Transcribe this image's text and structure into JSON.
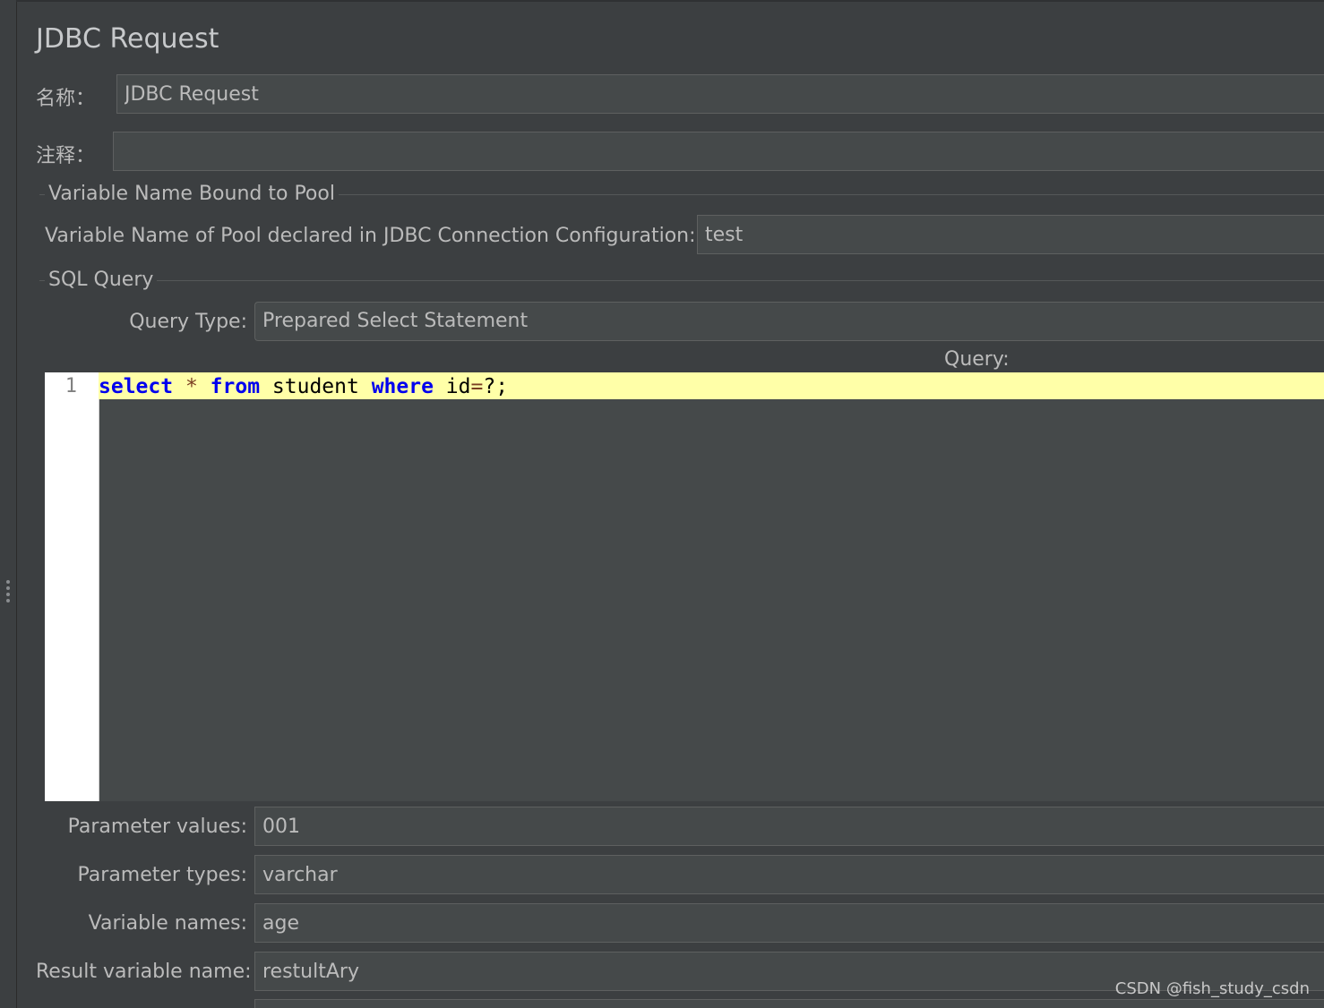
{
  "panel": {
    "title": "JDBC Request",
    "name_label": "名称：",
    "name_value": "JDBC Request",
    "comment_label": "注释：",
    "comment_value": ""
  },
  "pool_group": {
    "title": "Variable Name Bound to Pool",
    "pool_label": "Variable Name of Pool declared in JDBC Connection Configuration:",
    "pool_value": "test"
  },
  "sql_group": {
    "title": "SQL Query",
    "query_type_label": "Query Type:",
    "query_type_value": "Prepared Select Statement",
    "query_label": "Query:",
    "editor": {
      "line_number": "1",
      "tokens": [
        "select",
        " ",
        "*",
        " ",
        "from",
        " student ",
        "where",
        " id",
        "=",
        "?;"
      ]
    }
  },
  "params": {
    "values_label": "Parameter values:",
    "values_value": "001",
    "types_label": "Parameter types:",
    "types_value": "varchar",
    "varnames_label": "Variable names:",
    "varnames_value": "age",
    "result_label": "Result variable name:",
    "result_value": "restultAry"
  },
  "watermark": "CSDN @fish_study_csdn",
  "colors": {
    "background": "#3c3f41",
    "field_bg": "#45494a",
    "current_line": "#ffffa8",
    "keyword": "#0000ee"
  }
}
